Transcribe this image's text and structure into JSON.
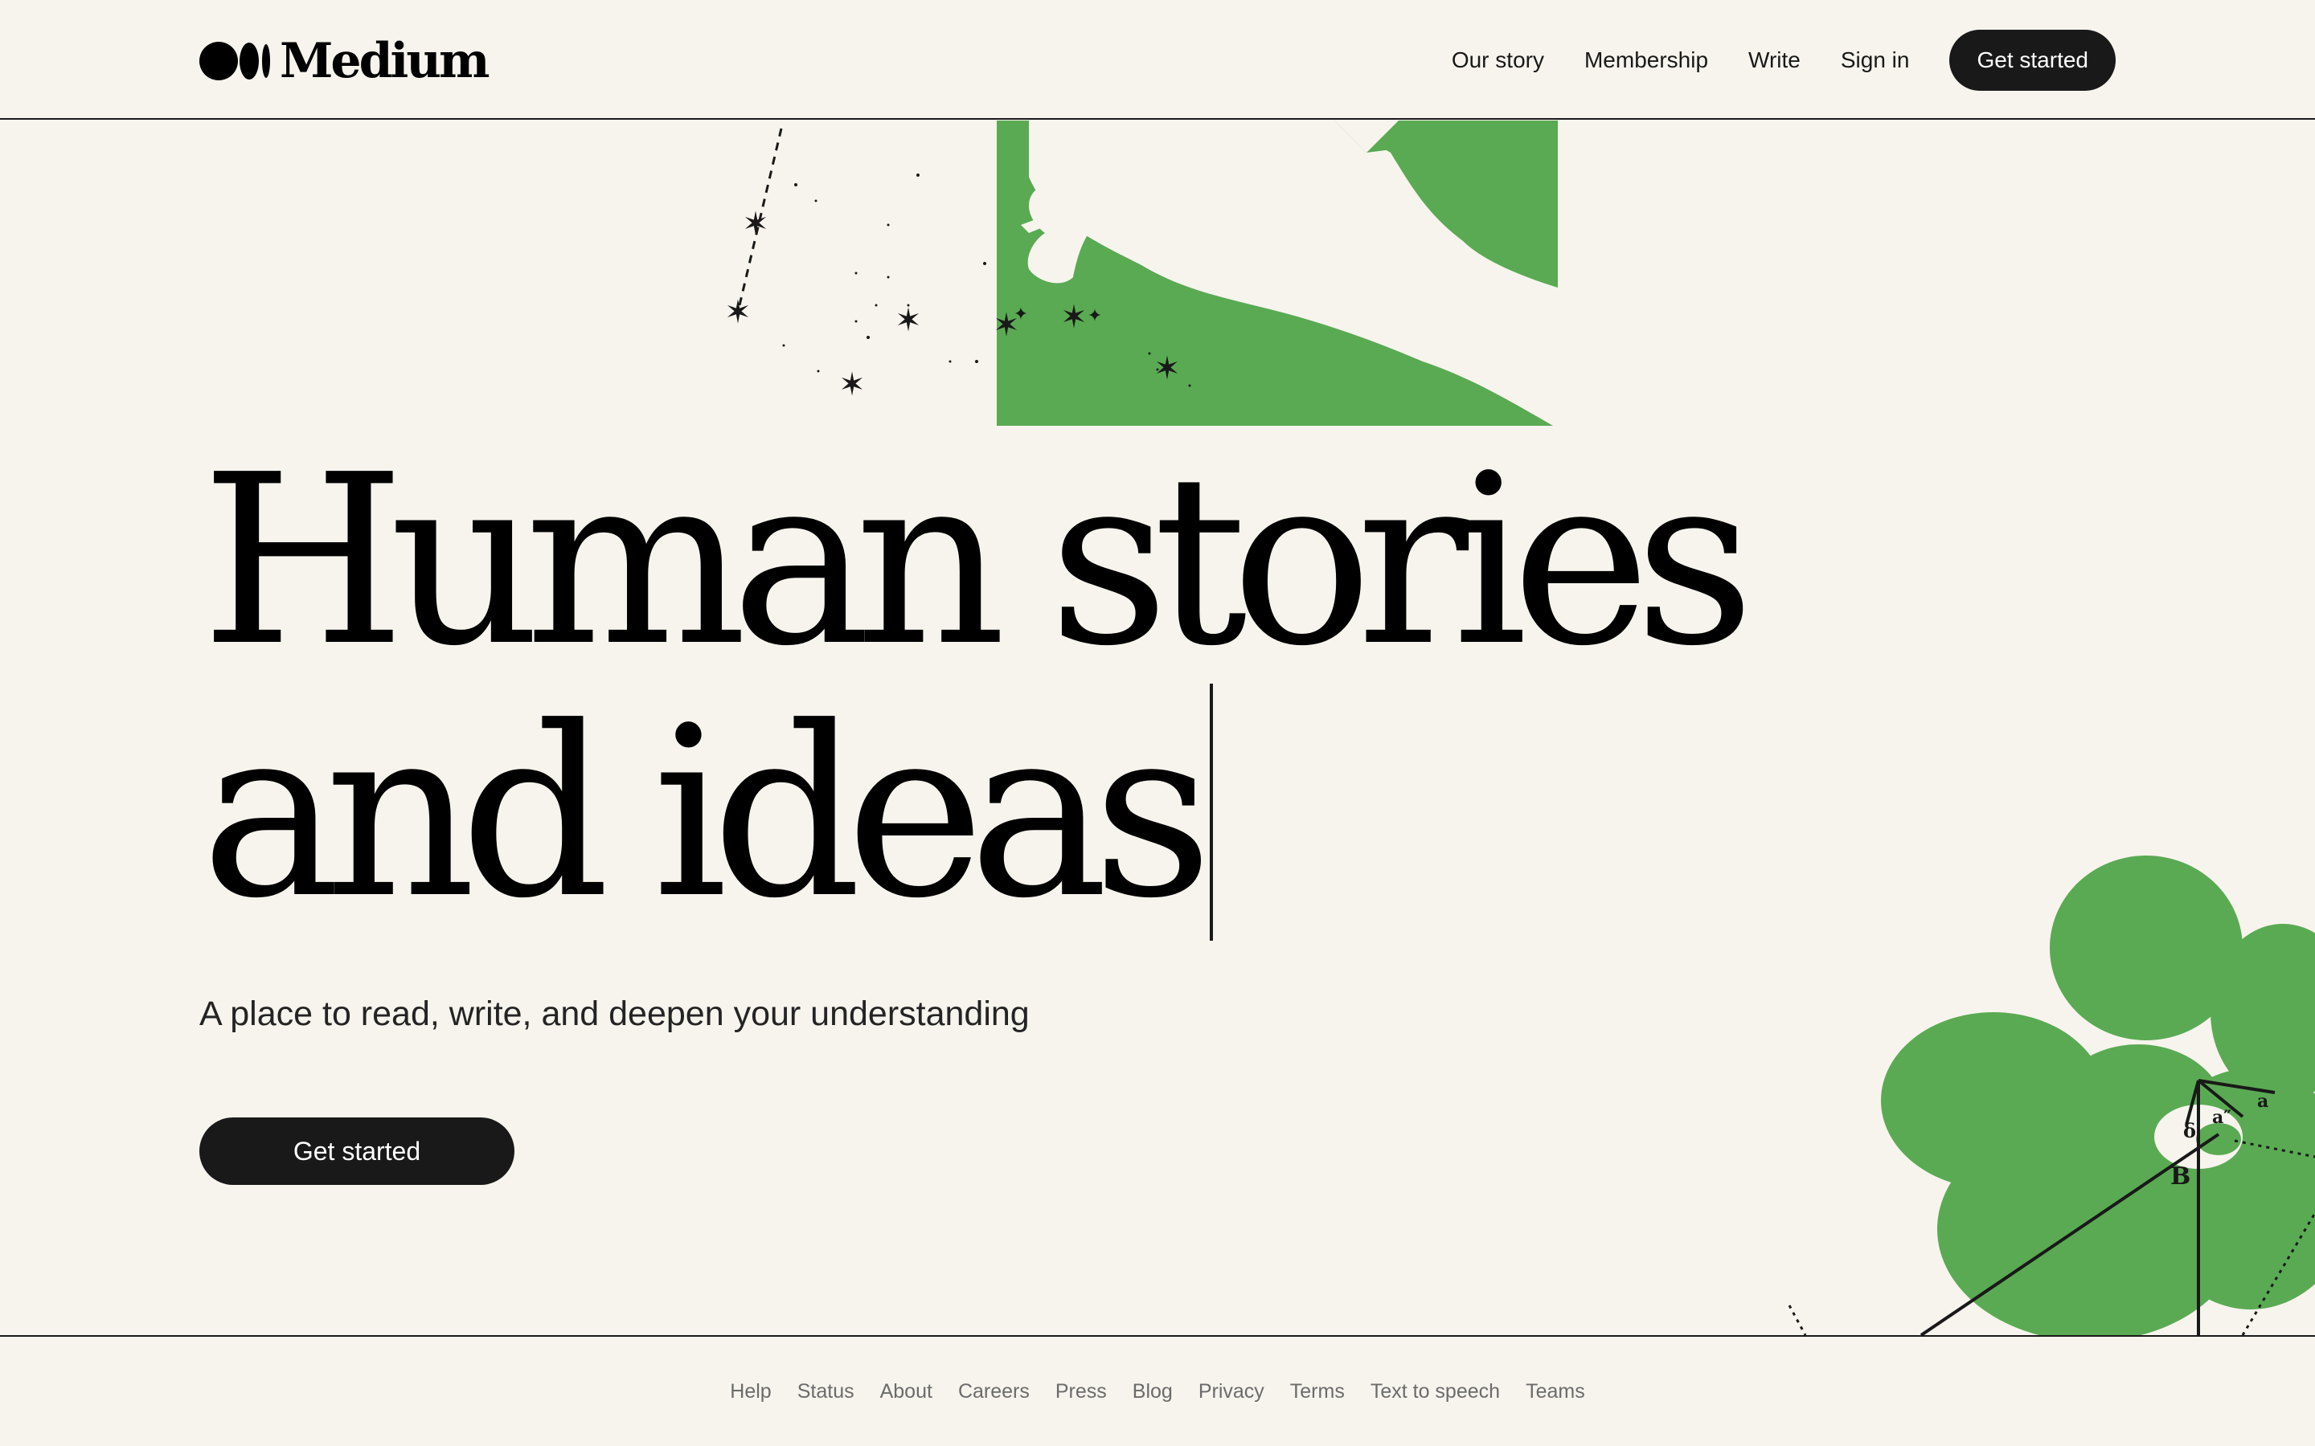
{
  "header": {
    "logo_text": "Medium",
    "nav": {
      "our_story": "Our story",
      "membership": "Membership",
      "write": "Write",
      "sign_in": "Sign in",
      "get_started": "Get started"
    }
  },
  "hero": {
    "title_line_1": "Human stories",
    "title_line_2": "and ideas",
    "subtitle": "A place to read, write, and deepen your understanding",
    "cta": "Get started"
  },
  "illustration_labels": {
    "b": "B",
    "a_prime": "a″",
    "delta": "δ",
    "a": "a"
  },
  "footer": {
    "links": [
      "Help",
      "Status",
      "About",
      "Careers",
      "Press",
      "Blog",
      "Privacy",
      "Terms",
      "Text to speech",
      "Teams"
    ]
  },
  "colors": {
    "background": "#f7f4ed",
    "ink": "#191919",
    "accent_green": "#5aaa53",
    "footer_text": "#6b6b6b"
  },
  "icons": [
    "medium-logo-icon",
    "caret-cursor-icon"
  ]
}
